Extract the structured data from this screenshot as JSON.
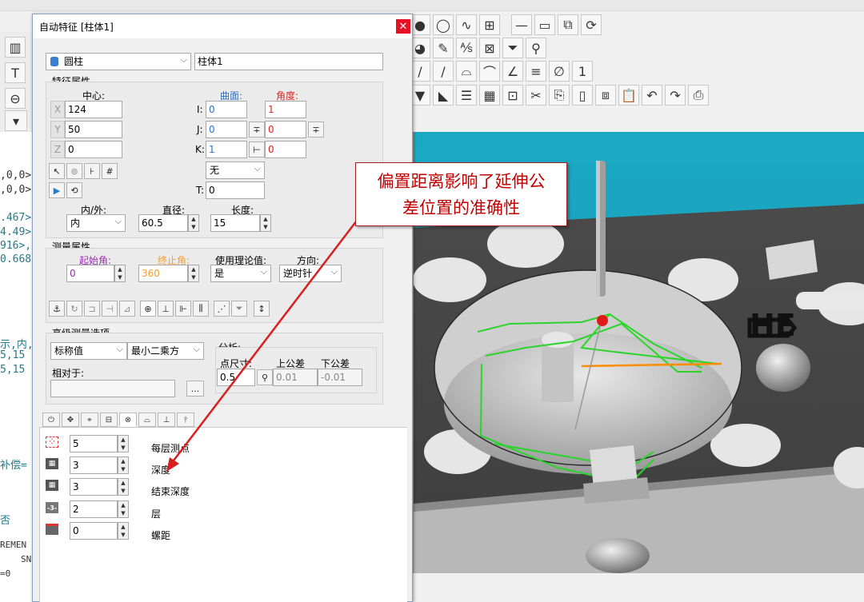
{
  "background": {
    "code_lines": [
      ",0,0>",
      ",0,0>",
      ".467>",
      "4.49>",
      "916>,",
      "0.668",
      "示,内,",
      "5,15",
      "5,15",
      "补偿=",
      "否",
      "REMEN",
      "SN",
      "=0"
    ]
  },
  "dialog": {
    "title": "自动特征 [柱体1]",
    "close_glyph": "✕",
    "feature_type": "圆柱",
    "feature_name": "柱体1",
    "feature_props": {
      "section_title": "特征属性",
      "center_header": "中心:",
      "surface_header": "曲面:",
      "angle_header": "角度:",
      "x_label": "X",
      "y_label": "Y",
      "z_label": "Z",
      "x": "124",
      "y": "50",
      "z": "0",
      "i_label": "I:",
      "j_label": "J:",
      "k_label": "K:",
      "t_label": "T:",
      "i": "0",
      "j": "0",
      "k": "1",
      "angle_i": "1",
      "angle_j": "0",
      "angle_k": "0",
      "t": "0",
      "thickness_mode": "无",
      "in_out_label": "内/外:",
      "in_out": "内",
      "diameter_label": "直径:",
      "diameter": "60.5",
      "length_label": "长度:",
      "length": "15"
    },
    "measure_props": {
      "section_title": "测量属性",
      "start_angle_label": "起始角:",
      "start_angle": "0",
      "end_angle_label": "终止角:",
      "end_angle": "360",
      "use_theo_label": "使用理论值:",
      "use_theo": "是",
      "direction_label": "方向:",
      "direction": "逆时针"
    },
    "advanced": {
      "section_title": "高级测量选项",
      "nominal_mode": "标称值",
      "fit_mode": "最小二乘方",
      "relative_to_label": "相对于:",
      "relative_to": "",
      "browse_label": "...",
      "analysis_label": "分析:",
      "point_size_label": "点尺寸:",
      "point_size": "0.5",
      "upper_tol_label": "上公差",
      "upper_tol": "0.01",
      "lower_tol_label": "下公差",
      "lower_tol": "-0.01"
    },
    "sampling": {
      "points_per_layer_label": "每层测点",
      "points_per_layer": "5",
      "depth_label": "深度",
      "depth": "3",
      "end_depth_label": "结束深度",
      "end_depth": "3",
      "layers_label": "层",
      "layers": "2",
      "pitch_label": "螺距",
      "pitch": "0"
    }
  },
  "callout": {
    "text_line1": "偏置距离影响了延伸公",
    "text_line2": "差位置的准确性"
  },
  "viewport": {
    "part_logo_text": "HE"
  },
  "colors": {
    "viewport_sky": "#1aa9c4",
    "part_gray": "#5a5a5a",
    "annotation_red": "#d81e1e",
    "path_green": "#2bd42b",
    "axis_orange": "#ff8c00"
  }
}
